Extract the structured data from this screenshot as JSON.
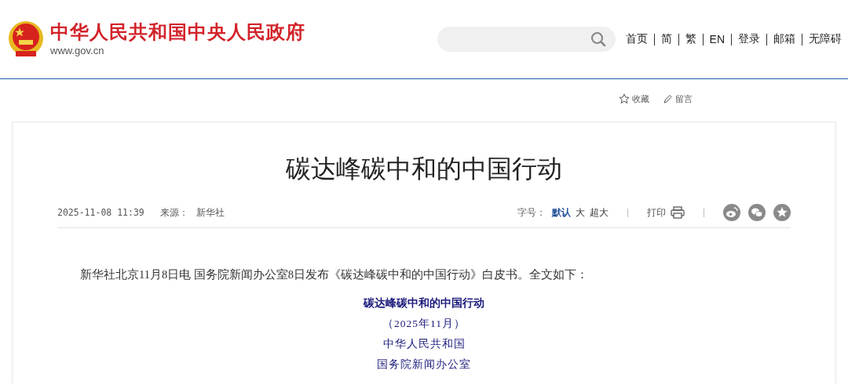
{
  "header": {
    "site_name": "中华人民共和国中央人民政府",
    "domain": "www.gov.cn",
    "nav": [
      {
        "label": "首页"
      },
      {
        "label": "简"
      },
      {
        "label": "繁"
      },
      {
        "label": "EN"
      },
      {
        "label": "登录"
      },
      {
        "label": "邮箱"
      },
      {
        "label": "无障碍"
      }
    ]
  },
  "toolbar": [
    {
      "kind": "star",
      "label": "收藏"
    },
    {
      "kind": "pen",
      "label": "留言"
    }
  ],
  "article": {
    "title": "碳达峰碳中和的中国行动",
    "meta": {
      "date": "2025-11-08 11:39",
      "source_label": "来源：",
      "source": "新华社",
      "font_size_label": "字号：",
      "font_sizes": [
        {
          "label": "默认",
          "selected": true
        },
        {
          "label": "大",
          "selected": false
        },
        {
          "label": "超大",
          "selected": false
        }
      ],
      "print_label": "打印",
      "share": [
        {
          "kind": "weibo"
        },
        {
          "kind": "wechat"
        },
        {
          "kind": "favorite"
        }
      ]
    },
    "lead": "新华社北京11月8日电 国务院新闻办公室8日发布《碳达峰碳中和的中国行动》白皮书。全文如下：",
    "centered_lines": [
      {
        "text": "碳达峰碳中和的中国行动",
        "bold": true
      },
      {
        "text": "（2025年11月）",
        "bold": false
      },
      {
        "text": "中华人民共和国",
        "bold": false
      },
      {
        "text": "国务院新闻办公室",
        "bold": false
      }
    ]
  }
}
